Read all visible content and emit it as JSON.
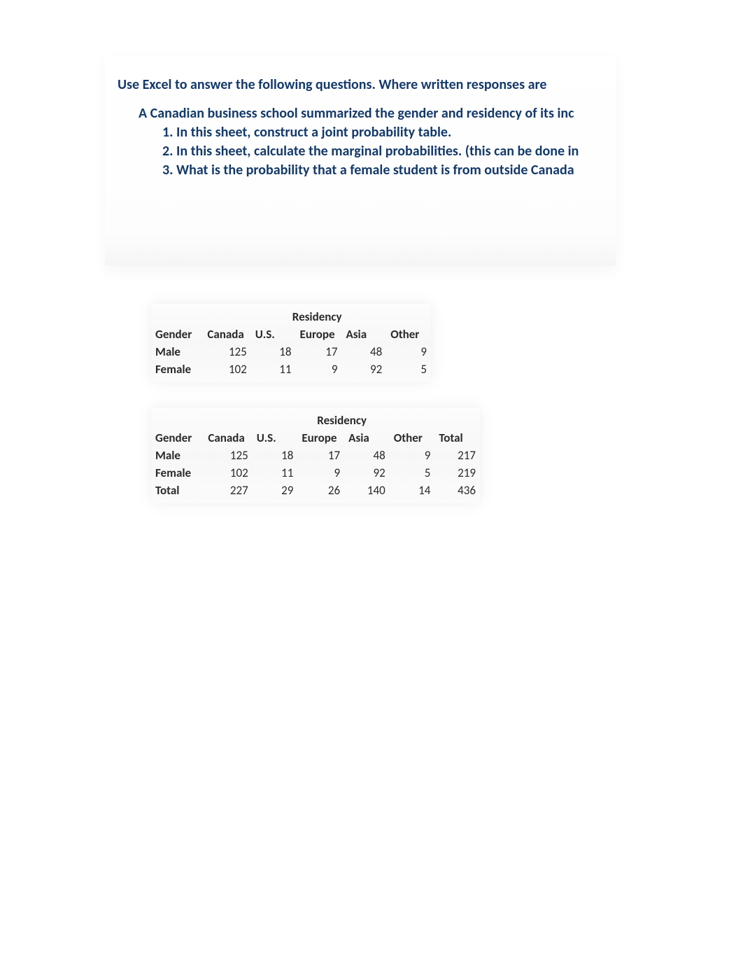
{
  "instructions": {
    "heading": "Use Excel to answer the following questions.  Where written responses are",
    "context": "A Canadian business school summarized the gender and residency of its inc",
    "item1": "1. In this sheet, construct a joint probability table.",
    "item2": "2. In this sheet, calculate the marginal probabilities. (this can be done in",
    "item3": "3. What is the probability that a female student is from outside Canada"
  },
  "table1": {
    "top_header": "Residency",
    "col_gender": "Gender",
    "cols": [
      "Canada",
      "U.S.",
      "Europe",
      "Asia",
      "Other"
    ],
    "rows": [
      {
        "label": "Male",
        "v": [
          125,
          18,
          17,
          48,
          9
        ]
      },
      {
        "label": "Female",
        "v": [
          102,
          11,
          9,
          92,
          5
        ]
      }
    ]
  },
  "table2": {
    "top_header": "Residency",
    "col_gender": "Gender",
    "cols": [
      "Canada",
      "U.S.",
      "Europe",
      "Asia",
      "Other",
      "Total"
    ],
    "rows": [
      {
        "label": "Male",
        "v": [
          125,
          18,
          17,
          48,
          9,
          217
        ]
      },
      {
        "label": "Female",
        "v": [
          102,
          11,
          9,
          92,
          5,
          219
        ]
      },
      {
        "label": "Total",
        "v": [
          227,
          29,
          26,
          140,
          14,
          436
        ]
      }
    ]
  }
}
